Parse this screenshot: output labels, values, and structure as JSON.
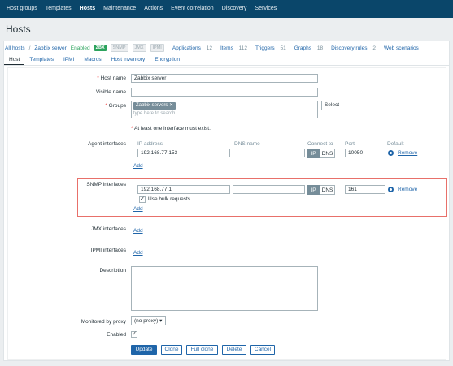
{
  "topnav": [
    "Host groups",
    "Templates",
    "Hosts",
    "Maintenance",
    "Actions",
    "Event correlation",
    "Discovery",
    "Services"
  ],
  "page_title": "Hosts",
  "hostnav": {
    "all_hosts": "All hosts",
    "separator": "/",
    "host_name": "Zabbix server",
    "status": "Enabled",
    "badges": [
      "ZBX",
      "SNMP",
      "JMX",
      "IPMI"
    ],
    "applications": "Applications",
    "applications_count": "12",
    "items": "Items",
    "items_count": "112",
    "triggers": "Triggers",
    "triggers_count": "51",
    "graphs": "Graphs",
    "graphs_count": "18",
    "discovery": "Discovery rules",
    "discovery_count": "2",
    "web": "Web scenarios"
  },
  "tabs": [
    "Host",
    "Templates",
    "IPMI",
    "Macros",
    "Host inventory",
    "Encryption"
  ],
  "form": {
    "host_name_label": "Host name",
    "host_name_value": "Zabbix server",
    "visible_name_label": "Visible name",
    "visible_name_value": "",
    "groups_label": "Groups",
    "group_tag": "Zabbix servers",
    "groups_placeholder": "type here to search",
    "select_label": "Select",
    "interface_note": "At least one interface must exist.",
    "agent_label": "Agent interfaces",
    "col_ip": "IP address",
    "col_dns": "DNS name",
    "col_connect": "Connect to",
    "col_port": "Port",
    "col_default": "Default",
    "agent_ip": "192.168.77.153",
    "agent_dns": "",
    "agent_port": "10050",
    "ip_label": "IP",
    "dns_label": "DNS",
    "remove_label": "Remove",
    "add_label": "Add",
    "snmp_label": "SNMP interfaces",
    "snmp_ip": "192.168.77.1",
    "snmp_dns": "",
    "snmp_port": "161",
    "bulk_label": "Use bulk requests",
    "jmx_label": "JMX interfaces",
    "ipmi_label": "IPMI interfaces",
    "description_label": "Description",
    "description_value": "",
    "proxy_label": "Monitored by proxy",
    "proxy_value": "(no proxy)",
    "enabled_label": "Enabled",
    "buttons": {
      "update": "Update",
      "clone": "Clone",
      "full_clone": "Full clone",
      "delete": "Delete",
      "cancel": "Cancel"
    }
  }
}
